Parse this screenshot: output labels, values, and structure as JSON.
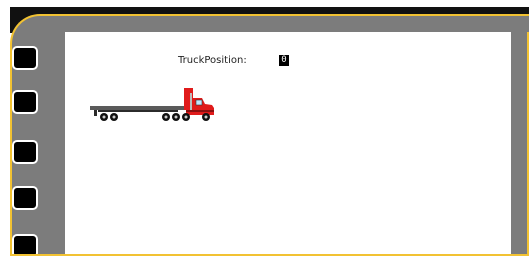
{
  "stage": {
    "truck_position_label": "TruckPosition:",
    "truck_position_value": "0"
  },
  "truck": {
    "icon": "semi-truck-icon",
    "cab_color": "#e01b1b",
    "trailer_color": "#5a5a5a"
  },
  "theme": {
    "frame_gray": "#7c7c7c",
    "frame_accent": "#f2c232",
    "header_dark": "#111111"
  }
}
